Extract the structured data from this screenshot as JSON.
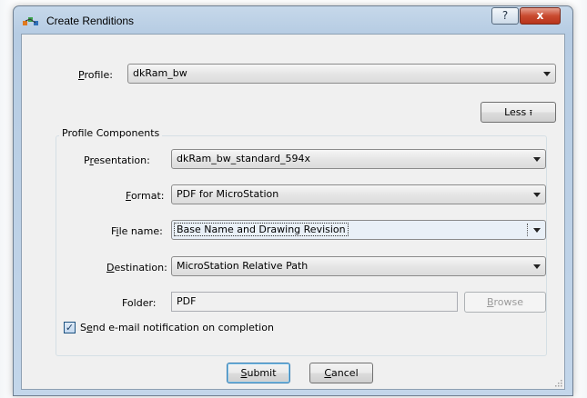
{
  "window": {
    "title": "Create Renditions",
    "help_label": "?",
    "close_label": "x"
  },
  "profile": {
    "label_mnemonic": "P",
    "label_rest": "rofile:",
    "value": "dkRam_bw"
  },
  "less_button": {
    "label": "Less",
    "glyph": "⭱"
  },
  "components": {
    "title": "Profile Components",
    "presentation": {
      "label_a": "P",
      "label_m": "r",
      "label_b": "esentation:",
      "value": "dkRam_bw_standard_594x"
    },
    "format": {
      "label_m": "F",
      "label_b": "ormat:",
      "value": "PDF for MicroStation"
    },
    "file_name": {
      "label_a": "F",
      "label_m": "i",
      "label_b": "le name:",
      "value": "Base Name and Drawing Revision"
    },
    "destination": {
      "label_m": "D",
      "label_b": "estination:",
      "value": "MicroStation Relative Path"
    },
    "folder": {
      "label": "Folder:",
      "value": "PDF"
    },
    "browse": {
      "label_m": "B",
      "label_b": "rowse"
    }
  },
  "notification": {
    "checked": true,
    "check_glyph": "✓",
    "label_a": "S",
    "label_m": "e",
    "label_b": "nd e-mail notification on completion"
  },
  "actions": {
    "submit_m": "S",
    "submit_b": "ubmit",
    "cancel_m": "C",
    "cancel_b": "ancel"
  },
  "colors": {
    "titlebar": "#b6cce3",
    "client": "#f0f0f0",
    "close_button": "#c94a2f",
    "default_button_border": "#3c7fb1"
  }
}
